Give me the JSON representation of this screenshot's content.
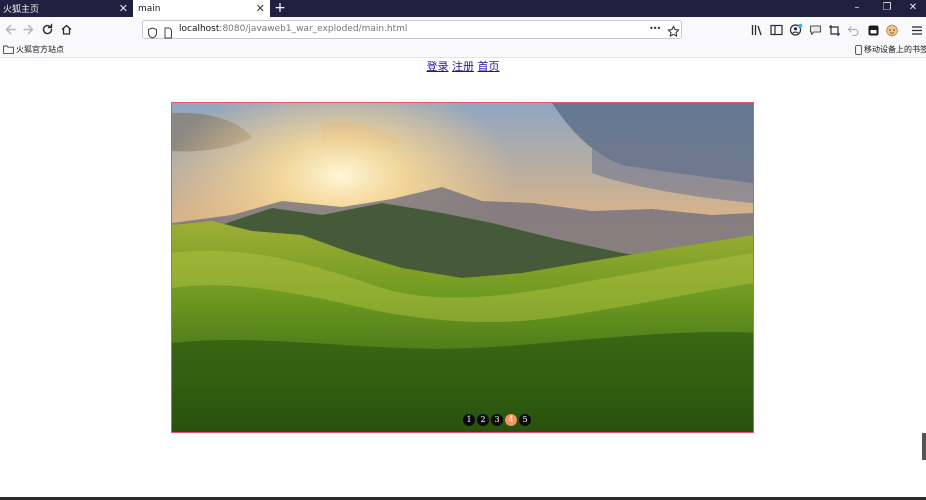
{
  "browser": {
    "tabs": [
      {
        "label": "火狐主页",
        "close": "✕"
      },
      {
        "label": "main",
        "close": "✕"
      }
    ],
    "new_tab": "+",
    "url_host": "localhost",
    "url_rest": ":8080/javaweb1_war_exploded/main.html",
    "page_actions": "•••",
    "window_controls": {
      "minimize": "–",
      "restore": "❐",
      "close": "✕"
    },
    "bookmarks": {
      "left": "火狐官方站点",
      "right": "移动设备上的书签"
    }
  },
  "page": {
    "links": [
      "登录",
      "注册",
      "首页"
    ],
    "slider": {
      "dots": [
        "1",
        "2",
        "3",
        "4",
        "5"
      ],
      "active_index": 4
    }
  },
  "colors": {
    "tabstrip": "#1f2140",
    "link": "#2a0f9a",
    "slider_border": "#e8546a",
    "active_dot": "#f3935e"
  }
}
